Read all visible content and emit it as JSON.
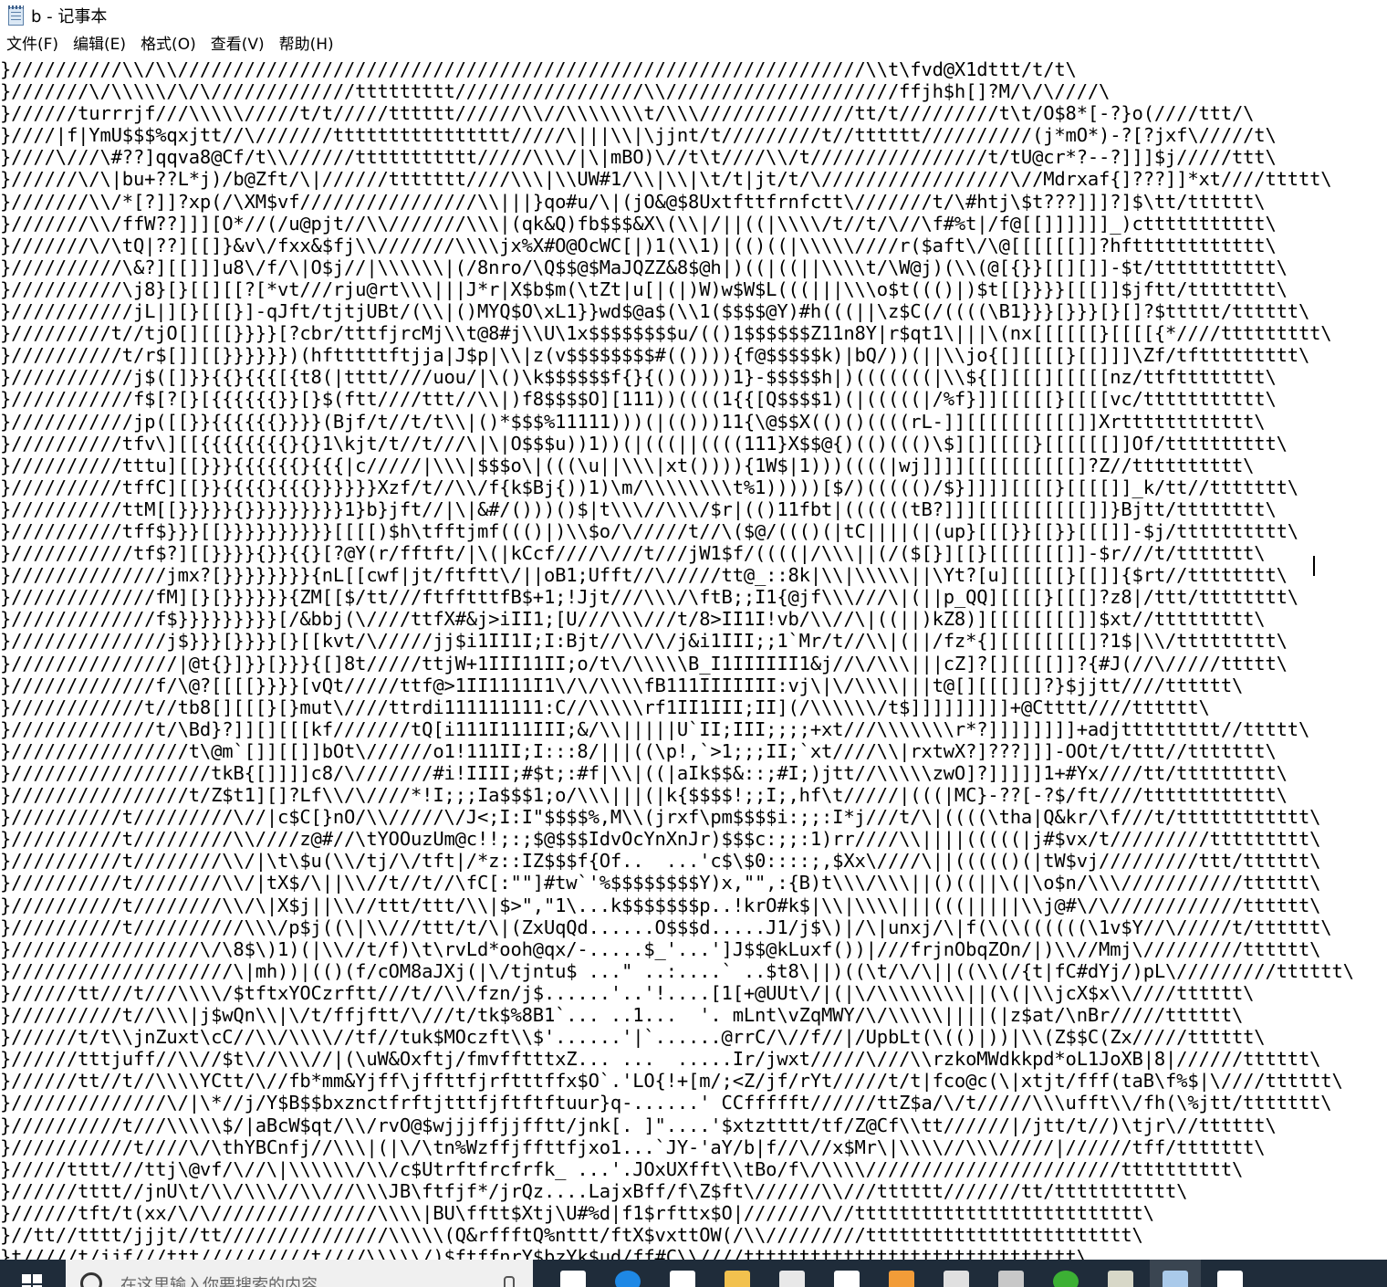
{
  "window": {
    "title": "b - 记事本"
  },
  "menu": {
    "items": [
      "文件(F)",
      "编辑(E)",
      "格式(O)",
      "查看(V)",
      "帮助(H)"
    ]
  },
  "editor": {
    "lines": [
      "}//////////\\\\/\\\\//////////////////////////////////////////////////////////////\\\\t\\fvd@X1dttt/t/t\\",
      "}///////\\/\\\\\\\\\\/\\/\\/////////////ttttttttt/////////////////\\\\/////////////////////ffjh$h[]?M/\\/\\////\\",
      "}//////turrrjf///\\\\\\\\\\/////t/t/////tttttt//////\\\\//\\\\\\\\\\\\\\t/\\\\\\//////////////tt/t/////////t\\t/O$8*[-?}o(////ttt/\\",
      "}////|f|YmU$$$%qxjtt//\\///////tttttttttttttttt/////\\|||\\\\|\\jjnt/t/////////t//tttttt//////////(j*mO*)-?[?jxf\\/////t\\",
      "}////\\///\\#??]qqva8@Cf/t\\\\//////ttttttttttt/////\\\\\\/|\\|mBO)\\//t\\t////\\\\/t////////////////t/tU@cr*?--?]]]$j/////ttt\\",
      "}//////\\/\\|bu+??L*j)/b@Zft/\\|//////ttttttt////\\\\\\|\\\\UW#1/\\\\|\\\\|\\t/t|jt/t/\\/////////////////\\//Mdrxaf{]???]]*xt////ttttt\\",
      "}///////\\\\/*[?]]?xp(/\\XM$vf////////////////\\\\|||}qo#u/\\|(jO&@$8Uxtfttfrnfctt\\///////t/\\#htj\\$t???]]]?]$\\tt/tttttt\\",
      "}///////\\\\/ffW??]]][O*//(/u@pjt//\\\\///////\\\\\\|(qk&Q)fb$$$&X\\(\\\\|/||((|\\\\\\\\/t//t/\\//\\f#%t|/f@[[]]]]]]_)cttttttttttt\\",
      "}///////\\/\\tQ|??][[]}&v\\/fxx&$fj\\\\///////\\\\\\\\jx%X#O@OcWC[|)1(\\\\1)|(()((|\\\\\\\\\\////r($aft\\/\\@[[[[[[]]?hftttttttttttt\\",
      "}//////////\\&?][[]]]u8\\/f/\\|O$j//|\\\\\\\\\\\\|(/8nro/\\Q$$@$MaJQZZ&8$@h|)((|((||\\\\\\\\t/\\W@j)(\\\\(@[{}}[[][]]-$t/ttttttttttt\\",
      "}//////////\\j8}[}[[][[?[*vt///rju@rt\\\\\\|||J*r|X$b$m(\\tZt|u[|(|)W)w$W$L(((|||\\\\\\o$t((()|)$t[[}}}}[[[]]$jftt/tttttttt\\",
      "}///////////jL|][}[[[}]-qJft/tjtjUBt/(\\\\|()MYQ$O\\xL1}}wd$@a$(\\\\1($$$$@Y)#h(((||\\z$C(/((((\\B1}}}[}}}[}[]?$ttttt/tttttt\\",
      "}/////////t//tjO[][[[}}}}[?cbr/tttfjrcMj\\\\t@8#j\\\\U\\1x$$$$$$$$u/(()1$$$$$$Z11n8Y|r$qt1\\|||\\(nx[[[[[[}[[[[{*////ttttttttt\\",
      "}//////////t/r$[]][[}}}}}})(hftttttftjja|J$p|\\\\|z(v$$$$$$$$#(()))){f@$$$$$k)|bQ/))(||\\\\jo{[][[[[}[[]]]\\Zf/tfttttttttt\\",
      "}///////////j$([]}}{{}{{{[{t8(|tttt////uou/|\\()\\k$$$$$$f{}{()())))1}-$$$$$h|)(((((((|\\\\${[][[[][[[[[nz/ttftttttttt\\",
      "}///////////f$[?[}[{{{{{{}}[}$(ftt////ttt//\\\\|)f8$$$$O][111))((((1{{[Q$$$$1)(|(((((|/%f}]][[[[[}[[[[vc/ttttttttttt\\",
      "}///////////jp([[}}{{{{{{}}}}(Bjf/t//t/t\\\\|()*$$$%11111)))(|(()))11{\\@$$X(()()((((rL-]][[[[[[[[[[]]Xrtttttttttttt\\",
      "}//////////tfv\\][[{{{{{{{{}{}1\\kjt/t//t///\\|\\|O$$$u))1))(|(((||((((111}X$$@{)(()((()\\$][][[[[}[[[[[[]]Of/tttttttttt\\",
      "}//////////tttu][[}}}{{{{{{}{{{|c/////|\\\\\\|$$$o\\|(((\\u||\\\\\\|xt()))){1W$|1)))((((|wj]]]][[[[[[[[[[]?Z//tttttttttt\\",
      "}//////////tffC][[}}{{{{}{{{}}}}}}Xzf/t//\\\\/f{k$Bj{))1)\\m/\\\\\\\\\\\\\\\\t%1)))))[$/)((((()/$}]]]][[[[}[[[[]]_k/tt//ttttttt\\",
      "}//////////ttM[[}}}}}{}}}}}}}}}1}b}jft//|\\|&#/()))()$|t\\\\\\//\\\\\\/$r|(()11fbt|((((((tB?]]][[[[[[[[[[]]}Bjtt/tttttttt\\",
      "}//////////tff$}}}[[}}}}}}}}}}[[[[)$h\\tfftjmf((()|)\\\\$o/\\/////t//\\($@/((()(|tC||||(|(up}[[[}}[[}}[[[]]-$j/tttttttttt\\",
      "}///////////tf$?][[}}}}{}}{{}[?@Y(r/fftft/|\\(|kCcf////\\///t///jW1$f/((((|/\\\\\\||(/($[}][[}[[[[[[[]]-$r///t/ttttttt\\",
      "}//////////////jmx?[}}}}}}}}{nL[[cwf|jt/ftftt\\/||oB1;Ufft//\\/////tt@_::8k|\\\\|\\\\\\\\\\||\\Yt?[u][[[[[}[[]]{$rt//tttttttt\\",
      "}/////////////fM][}[}}}}}}{ZM[[$/tt///ftfftttfB$+1;!Jjt///\\\\\\/\\ftB;;I1{@jf\\\\\\///\\|(||p_QQ][[[[}[[[]?z8|/ttt/tttttttt\\",
      "}/////////////f$}}}}}}}}}[/&bbj(\\////ttfX#&j>iII1;[U///\\\\\\///t/8>II1I!vb/\\\\//\\|((||)kZ8)][[[[[[[[]]$xt//ttttttttt\\",
      "}//////////////j$}}}[}}}}[}[[kvt/\\/////jj$i1II1I;I:Bjt//\\\\/\\/j&i1III;;1`Mr/t//\\\\|(||/fz*{][[[[[[[[]?1$|\\\\/ttttttttt\\",
      "}///////////////|@t{}]}}[}}}{[]8t/////ttjW+1III11II;o/t\\/\\\\\\\\\\B_I1IIIIII1&j//\\/\\\\\\|||cZ]?[][[[[]]?{#J(//\\/////ttttt\\",
      "}/////////////f/\\@?[[[[}}}}[vQt/////ttf@>1II1111I1\\/\\/\\\\\\\\fB111IIIIIII:vj\\|\\/\\\\\\\\|||t@[][[[][]?}$jjtt////tttttt\\",
      "}////////////t//tb8[][[[}[}mut\\////ttrdi111111111:C//\\\\\\\\\\rf1II1III;II](/\\\\\\\\\\\\/t$]]]]]]]]]+@Ctttt////tttttt\\",
      "}/////////////t/\\Bd}?]][][[[kf///////tQ[i111I111III;&/\\\\|||||U`II;III;;;;+xt///\\\\\\\\\\\\\\r*?]]]]]]]]+adjttttttttt//ttttt\\",
      "}////////////////t\\@m`[]][[]]bOt\\//////o1!111II;I:::8/|||((\\p!,`>1;;;II;`xt////\\\\|rxtwX?]???]]]-OOt/t/ttt//ttttttt\\",
      "}//////////////////tkB{[]]]]c8/\\///////#i!IIII;#$t;:#f|\\\\|((|aIk$$&::;#I;)jtt//\\\\\\\\\\zwO]?]]]]]1+#Yx////tt/ttttttttt\\",
      "}////////////////t/Z$t1][]?Lf\\\\/\\////*!I;;;Ia$$$1;o/\\\\\\|||(|k{$$$$!;;I;,hf\\t/////|(((|MC}-??[-?$/ft////tttttttttttt\\",
      "}//////////t/////////\\//|c$C[}nO/\\\\/////\\/J<;I:I\"$$$$%,M\\\\(jrxf\\pm$$$$i:;;:I*j///t/\\|((((\\tha|Q&kr/\\f///t/tttttttttttt\\",
      "}//////////t/////////\\\\////z@#//\\tYOOuzUm@c!!;:;$@$$$IdvOcYnXnJr)$$$c:;;:1)rr////\\\\||||(((((|j#$vx/t/////////ttttttttt\\",
      "}//////////t////////\\\\/|\\t\\$u(\\\\/tj/\\/tft|/*z::IZ$$$f{Of..  ...'c$\\$0::::;,$Xx\\////\\||((((()(|tW$vj/////////ttt/tttttt\\",
      "}//////////t////////\\\\/|tX$/\\||\\\\//t//t//\\fC[:\"\"]#tw`'%$$$$$$$$Y)x,\"\",:{B)t\\\\\\/\\\\\\||()((||\\(|\\o$n/\\\\\\///////////tttttt\\",
      "}//////////t////////\\\\/\\|X$j||\\\\//ttt/ttt/\\\\|$>\",\"1\\...k$$$$$$$p..!krO#k$|\\\\|\\\\\\\\|||(((|||||\\\\j@#\\/\\////////////tttttt\\",
      "}//////////t//////////\\\\\\/p$j((\\|\\\\///ttt/t/\\|(ZxUqQd......O$$$d.....J1/j$\\)|/\\|unxj/\\|f(\\(\\((((((\\1v$Y//\\/////t/tttttt\\",
      "}/////////////////\\/\\8$\\)1)(|\\\\//t/f)\\t\\rvLd*ooh@qx/-.....$_'...']J$$@kLuxf())|///frjnObqZOn/|)\\\\//Mmj\\/////////tttttt\\",
      "}////////////////////\\|mh))|(()(f/cOM8aJXj(|\\/tjntu$ ...\" ..:....` ..$t8\\||)((\\t/\\/\\||((\\\\(/{t|fC#dYj/)pL\\/////////tttttt\\",
      "}//////tt///t///\\\\\\\\/$tftxYOCzrftt///t//\\\\/fzn/j$......'..'!....[1[+@UUt\\/|(|\\/\\\\\\\\\\\\\\\\||(\\(|\\\\jcX$x\\\\////tttttt\\",
      "}//////////t//\\\\\\|j$wQn\\\\|\\/t/ffjftt/\\///t/tk$%8B1`... ..1...  '. mLnt\\vZqMWY/\\/\\\\\\\\\\||||(|z$at/\\nBr/////tttttt\\",
      "}//////t/t\\\\jnZuxt\\cC//\\\\/\\\\\\\\//tf//tuk$MOczft\\\\$'......'|`......@rrC/\\//f//|/UpbLt(\\(()|))|\\\\(Z$$C(Zx/////tttttt\\",
      "}//////tttjuff//\\\\//$t\\//\\\\\\//|(\\uW&Oxftj/fmvfftttxZ... ...  .....Ir/jwxt/////\\///\\\\rzkoMWdkkpd*oL1JoXB|8|//////tttttt\\",
      "}//////tt//t//\\\\\\\\YCtt/\\//fb*mm&Yjff\\jffttfjrftttffx$O`.'LO{!+[m/;<Z/jf/rYt/////t/t|fco@c(\\|xtjt/fff(taB\\f%$|\\////tttttt\\",
      "}//////////////\\/|\\*//j/Y$B$$bxznctfrftjtttfjftftftuur}q-......' CCffffft//////ttZ$a/\\/t/////\\\\\\ufft\\\\/fh(\\%jtt/ttttttt\\",
      "}//////////t///\\\\\\\\\\$/|aBcW$qt/\\\\/rvO@$wjjjffjjfftt/jnk[. ]\"....'$xtztttt/tf/Z@Cf\\\\tt//////|/jtt/t//)\\tjr\\//tttttt\\",
      "}///////////t////\\/\\thYBCnfj//\\\\\\|(|\\/\\tn%Wzffjffttfjxo1...`JY-'aY/b|f//\\//x$Mr\\|\\\\\\\\//\\\\\\/////|//////tff/ttttttt\\",
      "}/////tttt///ttj\\@vf/\\//\\|\\\\\\\\\\\\/\\\\/c$Utrftfrcfrfk_ ...'.JOxUXfft\\\\tBo/f\\/\\\\\\\\///////////////////////tttttttttt\\",
      "}//////tttt//jnU\\t/\\\\/\\\\\\//\\\\///\\\\\\JB\\ftfjf*/jrQz....LajxBff/f\\Z$ft\\//////\\\\///tttttt///////tt/ttttttttttt\\",
      "}//////tft/t(xx/\\/\\///////////////\\\\\\\\|BU\\fftt$Xtj\\U#%d|f1$rfttx$O|///////\\//tttttttttttttttttttttttttt\\",
      "}//tt//tttt/jjjt//tt///////////////\\\\\\\\\\(Q&rffftQ%nttt/ftX$vxttOW(/\\\\/////////tttttttttttttttttttttttt\\",
      "}t/////t/jjf///ttt//////////t////\\\\\\\\\\/)$ftffnrY$bzYk$ud/ff#C\\\\////tttttttttttttttttttttttttttttt\\"
    ]
  },
  "taskbar": {
    "search_placeholder": "在这里输入你要搜索的内容",
    "icons": [
      {
        "name": "task-view-icon",
        "color": "#ffffff"
      },
      {
        "name": "edge-icon",
        "color": "#1e88e5"
      },
      {
        "name": "store-icon",
        "color": "#ffffff"
      },
      {
        "name": "file-explorer-icon",
        "color": "#f2c14e"
      },
      {
        "name": "app-icon-1",
        "color": "#e8e8e8"
      },
      {
        "name": "app-icon-2",
        "color": "#ffffff"
      },
      {
        "name": "app-icon-3",
        "color": "#f29c38"
      },
      {
        "name": "calculator-icon",
        "color": "#e0e0e0"
      },
      {
        "name": "terminal-icon",
        "color": "#c8c8c8"
      },
      {
        "name": "wechat-icon",
        "color": "#3cb034"
      },
      {
        "name": "app-icon-4",
        "color": "#d8d8c8"
      },
      {
        "name": "notepad-icon",
        "color": "#9fc3e7"
      },
      {
        "name": "app-icon-5",
        "color": "#ffffff"
      }
    ]
  }
}
